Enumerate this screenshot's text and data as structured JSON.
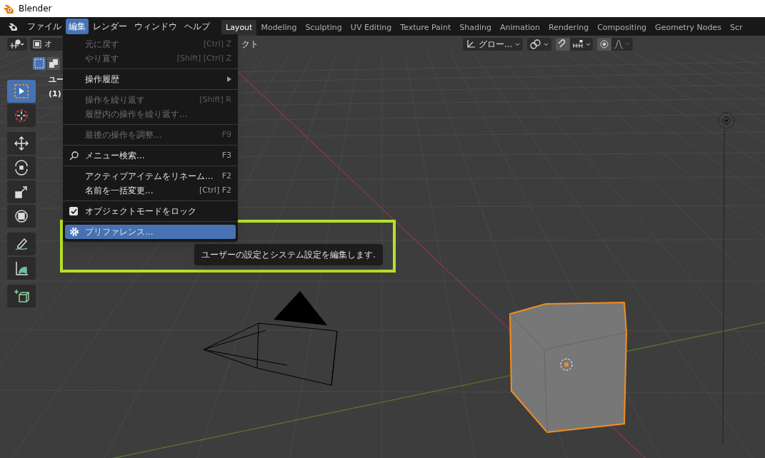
{
  "window": {
    "title": "Blender"
  },
  "menubar": [
    {
      "label": "ファイル",
      "selected": false
    },
    {
      "label": "編集",
      "selected": true
    },
    {
      "label": "レンダー",
      "selected": false
    },
    {
      "label": "ウィンドウ",
      "selected": false
    },
    {
      "label": "ヘルプ",
      "selected": false
    }
  ],
  "workspaces": [
    {
      "label": "Layout",
      "selected": true
    },
    {
      "label": "Modeling",
      "selected": false
    },
    {
      "label": "Sculpting",
      "selected": false
    },
    {
      "label": "UV Editing",
      "selected": false
    },
    {
      "label": "Texture Paint",
      "selected": false
    },
    {
      "label": "Shading",
      "selected": false
    },
    {
      "label": "Animation",
      "selected": false
    },
    {
      "label": "Rendering",
      "selected": false
    },
    {
      "label": "Compositing",
      "selected": false
    },
    {
      "label": "Geometry Nodes",
      "selected": false
    },
    {
      "label": "Scr",
      "selected": false
    }
  ],
  "header": {
    "mode_fragment": "オ",
    "object_menu_fragment": "クト",
    "orientation": "グロー...",
    "snap_on": true,
    "proportional_on": true
  },
  "viewport_overlay": {
    "view_name_fragment": "ユー",
    "object_fragment": "(1)"
  },
  "tools": [
    {
      "kind": "select",
      "selected": true
    },
    {
      "kind": "cursor",
      "selected": false
    },
    {
      "kind": "move",
      "selected": false
    },
    {
      "kind": "rotate",
      "selected": false
    },
    {
      "kind": "scale",
      "selected": false
    },
    {
      "kind": "transform",
      "selected": false
    },
    {
      "kind": "annotate",
      "selected": false
    },
    {
      "kind": "measure",
      "selected": false
    },
    {
      "kind": "add-cube",
      "selected": false
    }
  ],
  "edit_menu": [
    {
      "kind": "item",
      "label": "元に戻す",
      "shortcut": "[Ctrl] Z",
      "disabled": true,
      "selected": false
    },
    {
      "kind": "item",
      "label": "やり直す",
      "shortcut": "[Shift] [Ctrl] Z",
      "disabled": true,
      "selected": false
    },
    {
      "kind": "separator"
    },
    {
      "kind": "submenu",
      "label": "操作履歴",
      "disabled": false,
      "selected": false
    },
    {
      "kind": "separator"
    },
    {
      "kind": "item",
      "label": "操作を繰り返す",
      "shortcut": "[Shift] R",
      "disabled": true,
      "selected": false
    },
    {
      "kind": "item",
      "label": "履歴内の操作を繰り返す...",
      "disabled": true,
      "selected": false
    },
    {
      "kind": "separator"
    },
    {
      "kind": "item",
      "label": "最後の操作を調整...",
      "shortcut": "F9",
      "disabled": true,
      "selected": false
    },
    {
      "kind": "separator"
    },
    {
      "kind": "search",
      "label": "メニュー検索...",
      "shortcut": "F3",
      "disabled": false,
      "selected": false
    },
    {
      "kind": "separator"
    },
    {
      "kind": "item",
      "label": "アクティブアイテムをリネーム...",
      "shortcut": "F2",
      "disabled": false,
      "selected": false
    },
    {
      "kind": "item",
      "label": "名前を一括変更...",
      "shortcut": "[Ctrl] F2",
      "disabled": false,
      "selected": false
    },
    {
      "kind": "separator"
    },
    {
      "kind": "checkbox",
      "label": "オブジェクトモードをロック",
      "checked": true,
      "disabled": false,
      "selected": false
    },
    {
      "kind": "separator"
    },
    {
      "kind": "settings",
      "label": "プリファレンス...",
      "disabled": false,
      "selected": true
    }
  ],
  "tooltip": {
    "text": "ユーザーの設定とシステム設定を編集します."
  }
}
